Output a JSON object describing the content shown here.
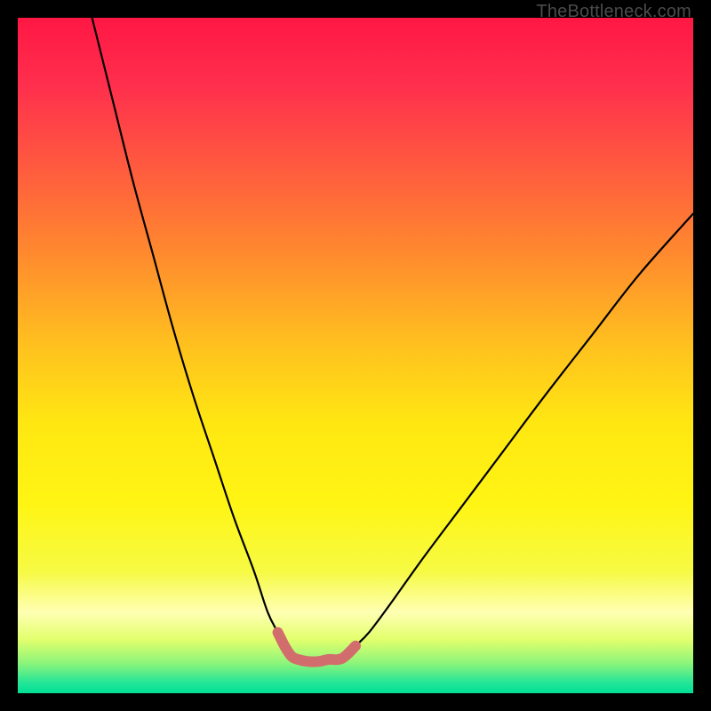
{
  "watermark": "TheBottleneck.com",
  "chart_data": {
    "type": "line",
    "title": "",
    "xlabel": "",
    "ylabel": "",
    "xlim": [
      0,
      100
    ],
    "ylim": [
      0,
      100
    ],
    "grid": false,
    "legend": false,
    "series": [
      {
        "name": "left-branch",
        "x": [
          11,
          14,
          17,
          20,
          23,
          26,
          29,
          32,
          35,
          37,
          38.5,
          39.5,
          40.5,
          41.5
        ],
        "y": [
          100,
          88,
          76,
          65,
          54,
          44,
          35,
          26,
          18,
          12,
          9,
          7,
          5.5,
          5
        ]
      },
      {
        "name": "right-branch",
        "x": [
          47.5,
          48.5,
          50,
          52,
          55,
          60,
          66,
          72,
          78,
          85,
          92,
          100
        ],
        "y": [
          5,
          5.5,
          7,
          9,
          13,
          20,
          28,
          36,
          44,
          53,
          62,
          71
        ]
      },
      {
        "name": "valley-highlight",
        "x": [
          38.5,
          39.5,
          40.5,
          41.5,
          43,
          44.5,
          46,
          47.5,
          48.5,
          50
        ],
        "y": [
          9,
          7,
          5.5,
          5,
          4.7,
          4.7,
          5,
          5,
          5.5,
          7
        ]
      }
    ],
    "gradient_stops": [
      {
        "offset": 0.0,
        "color": "#ff1744"
      },
      {
        "offset": 0.1,
        "color": "#ff2f4d"
      },
      {
        "offset": 0.22,
        "color": "#ff5a3f"
      },
      {
        "offset": 0.35,
        "color": "#ff8a2e"
      },
      {
        "offset": 0.48,
        "color": "#ffbf1f"
      },
      {
        "offset": 0.6,
        "color": "#ffe712"
      },
      {
        "offset": 0.72,
        "color": "#fff514"
      },
      {
        "offset": 0.82,
        "color": "#f6fa44"
      },
      {
        "offset": 0.88,
        "color": "#ffffb3"
      },
      {
        "offset": 0.92,
        "color": "#e3ff6d"
      },
      {
        "offset": 0.955,
        "color": "#8ef57a"
      },
      {
        "offset": 0.985,
        "color": "#22e598"
      },
      {
        "offset": 1.0,
        "color": "#00e096"
      }
    ],
    "highlight_color": "#d26d6d"
  }
}
